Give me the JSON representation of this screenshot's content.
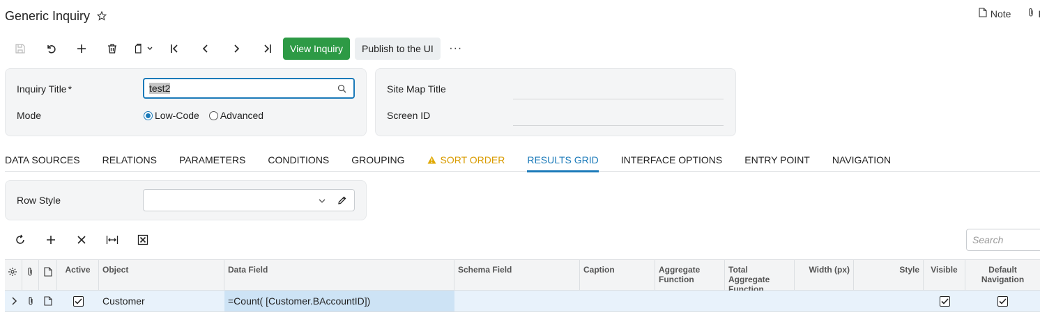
{
  "header": {
    "title": "Generic Inquiry",
    "note_label": "Note",
    "files_label": "F"
  },
  "toolbar": {
    "view_inquiry_label": "View Inquiry",
    "publish_label": "Publish to the UI",
    "more_label": "···"
  },
  "form": {
    "inquiry_title_label": "Inquiry Title",
    "required_mark": "*",
    "inquiry_title_value": "test2",
    "mode_label": "Mode",
    "mode_options": [
      "Low-Code",
      "Advanced"
    ],
    "mode_selected": "Low-Code",
    "site_map_title_label": "Site Map Title",
    "site_map_title_value": "",
    "screen_id_label": "Screen ID",
    "screen_id_value": ""
  },
  "tabs": [
    {
      "label": "DATA SOURCES"
    },
    {
      "label": "RELATIONS"
    },
    {
      "label": "PARAMETERS"
    },
    {
      "label": "CONDITIONS"
    },
    {
      "label": "GROUPING"
    },
    {
      "label": "SORT ORDER"
    },
    {
      "label": "RESULTS GRID"
    },
    {
      "label": "INTERFACE OPTIONS"
    },
    {
      "label": "ENTRY POINT"
    },
    {
      "label": "NAVIGATION"
    }
  ],
  "active_tab": "RESULTS GRID",
  "warning_tab": "SORT ORDER",
  "row_style": {
    "label": "Row Style",
    "value": ""
  },
  "search": {
    "placeholder": "Search"
  },
  "grid": {
    "columns": [
      "Active",
      "Object",
      "Data Field",
      "Schema Field",
      "Caption",
      "Aggregate Function",
      "Total Aggregate Function",
      "Width (px)",
      "Style",
      "Visible",
      "Default Navigation"
    ],
    "rows": [
      {
        "active": true,
        "object": "Customer",
        "data_field": "=Count( [Customer.BAccountID])",
        "schema_field": "",
        "caption": "",
        "aggregate_function": "",
        "total_aggregate_function": "",
        "width": "",
        "style": "",
        "visible": true,
        "default_navigation": true
      }
    ]
  },
  "colors": {
    "accent": "#1b7ab9",
    "primary_button": "#2d9a45",
    "warning": "#d99b00",
    "row_highlight": "#e8f2fb"
  }
}
